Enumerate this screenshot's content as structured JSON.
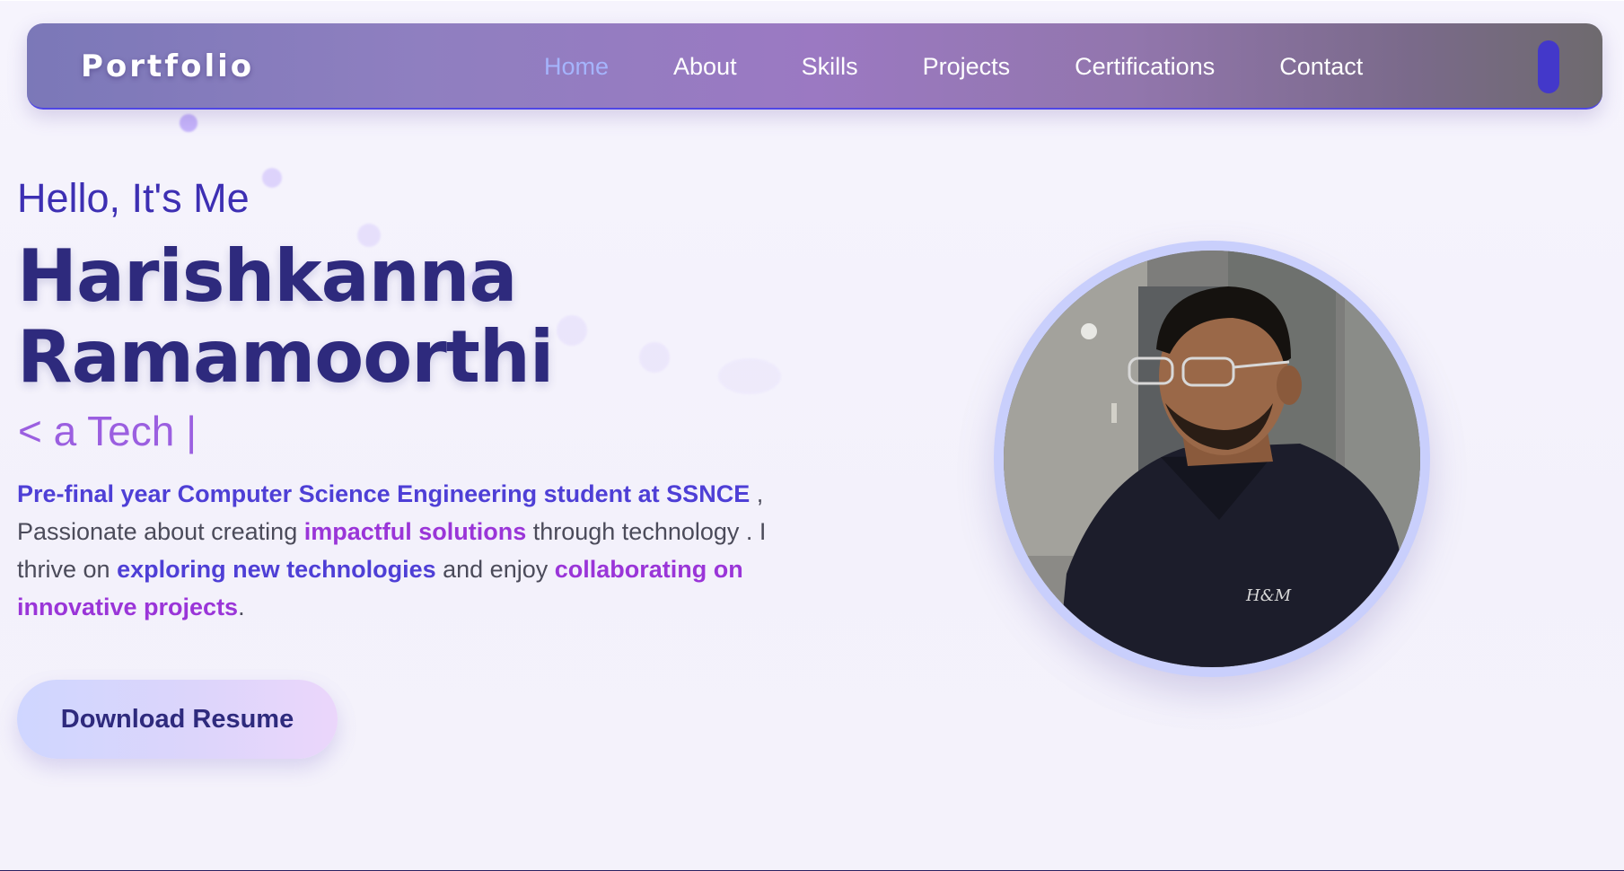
{
  "navbar": {
    "logo": "Portfolio",
    "links": [
      {
        "label": "Home",
        "active": true
      },
      {
        "label": "About",
        "active": false
      },
      {
        "label": "Skills",
        "active": false
      },
      {
        "label": "Projects",
        "active": false
      },
      {
        "label": "Certifications",
        "active": false
      },
      {
        "label": "Contact",
        "active": false
      }
    ],
    "menu_icon": "menu-toggle-icon"
  },
  "hero": {
    "greeting": "Hello, It's Me",
    "name_line1": "Harishkanna",
    "name_line2": "Ramamoorthi",
    "typed_text": "< a Tech |",
    "bio": {
      "h1": "Pre-final year Computer Science Engineering student at SSNCE",
      "t1": " , Passionate about creating ",
      "h2": "impactful solutions",
      "t2": " through technology . I thrive on ",
      "h3": "exploring new technologies",
      "t3": " and enjoy ",
      "h4": "collaborating on innovative projects",
      "t4": "."
    },
    "download_button": "Download Resume",
    "avatar_icon": "profile-photo"
  },
  "colors": {
    "accent_blue": "#4e3fd6",
    "accent_purple": "#9a35d8",
    "heading": "#2e2a7d",
    "nav_active": "#a5b4fc"
  }
}
